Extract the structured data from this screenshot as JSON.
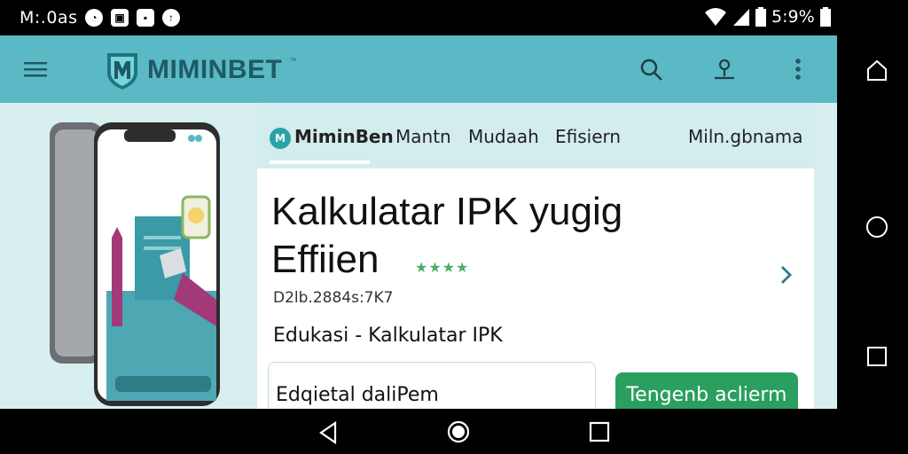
{
  "status_bar": {
    "time": "M:.0as",
    "battery": "5:9%"
  },
  "app": {
    "brand": "MIMINBET",
    "brand_mark": "™",
    "logo_letter": "M",
    "colors": {
      "topbar": "#5bb9c6",
      "accent": "#2a9f5f",
      "tabs_bg": "#d3eced"
    }
  },
  "tabs": [
    {
      "label": "MiminBen",
      "logo": "M"
    },
    {
      "label": "Mantn"
    },
    {
      "label": "Mudaah"
    },
    {
      "label": "Efisiern"
    },
    {
      "label": "Miln.gbnama"
    }
  ],
  "detail": {
    "title_line1": "Kalkulatar IPK yugig",
    "title_line2": "Effiien",
    "rating_stars": "★★★★",
    "meta": "D2lb.2884s:7K7",
    "category": "Edukasi - Kalkulatar IPK",
    "description": "Edqietal daliPem",
    "install_label": "Tengenb aclierm"
  },
  "icons": {
    "menu": "menu-icon",
    "search": "search-icon",
    "account": "account-icon",
    "more": "more-vert-icon",
    "back": "back-icon",
    "home": "home-icon",
    "recents": "recents-icon"
  }
}
